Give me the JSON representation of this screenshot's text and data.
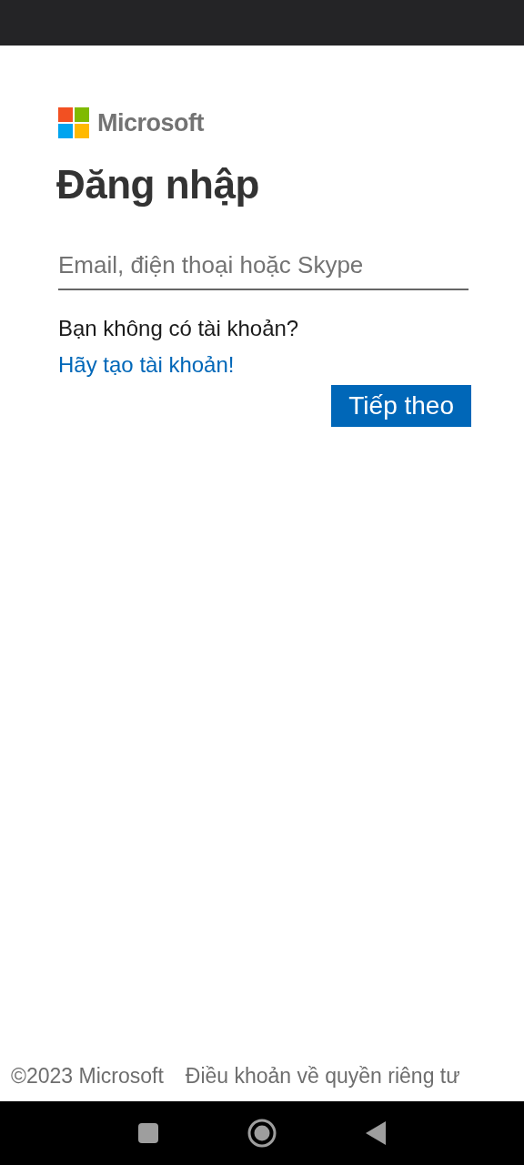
{
  "logo": {
    "text": "Microsoft"
  },
  "heading": "Đăng nhập",
  "email_field": {
    "placeholder": "Email, điện thoại hoặc Skype"
  },
  "signup_prompt": {
    "text": "Bạn không có tài khoản?",
    "link": "Hãy tạo tài khoản!"
  },
  "next_button": "Tiếp theo",
  "footer": {
    "copyright": "©2023 Microsoft",
    "links": [
      "Điều khoản về quyền riêng tư"
    ]
  }
}
